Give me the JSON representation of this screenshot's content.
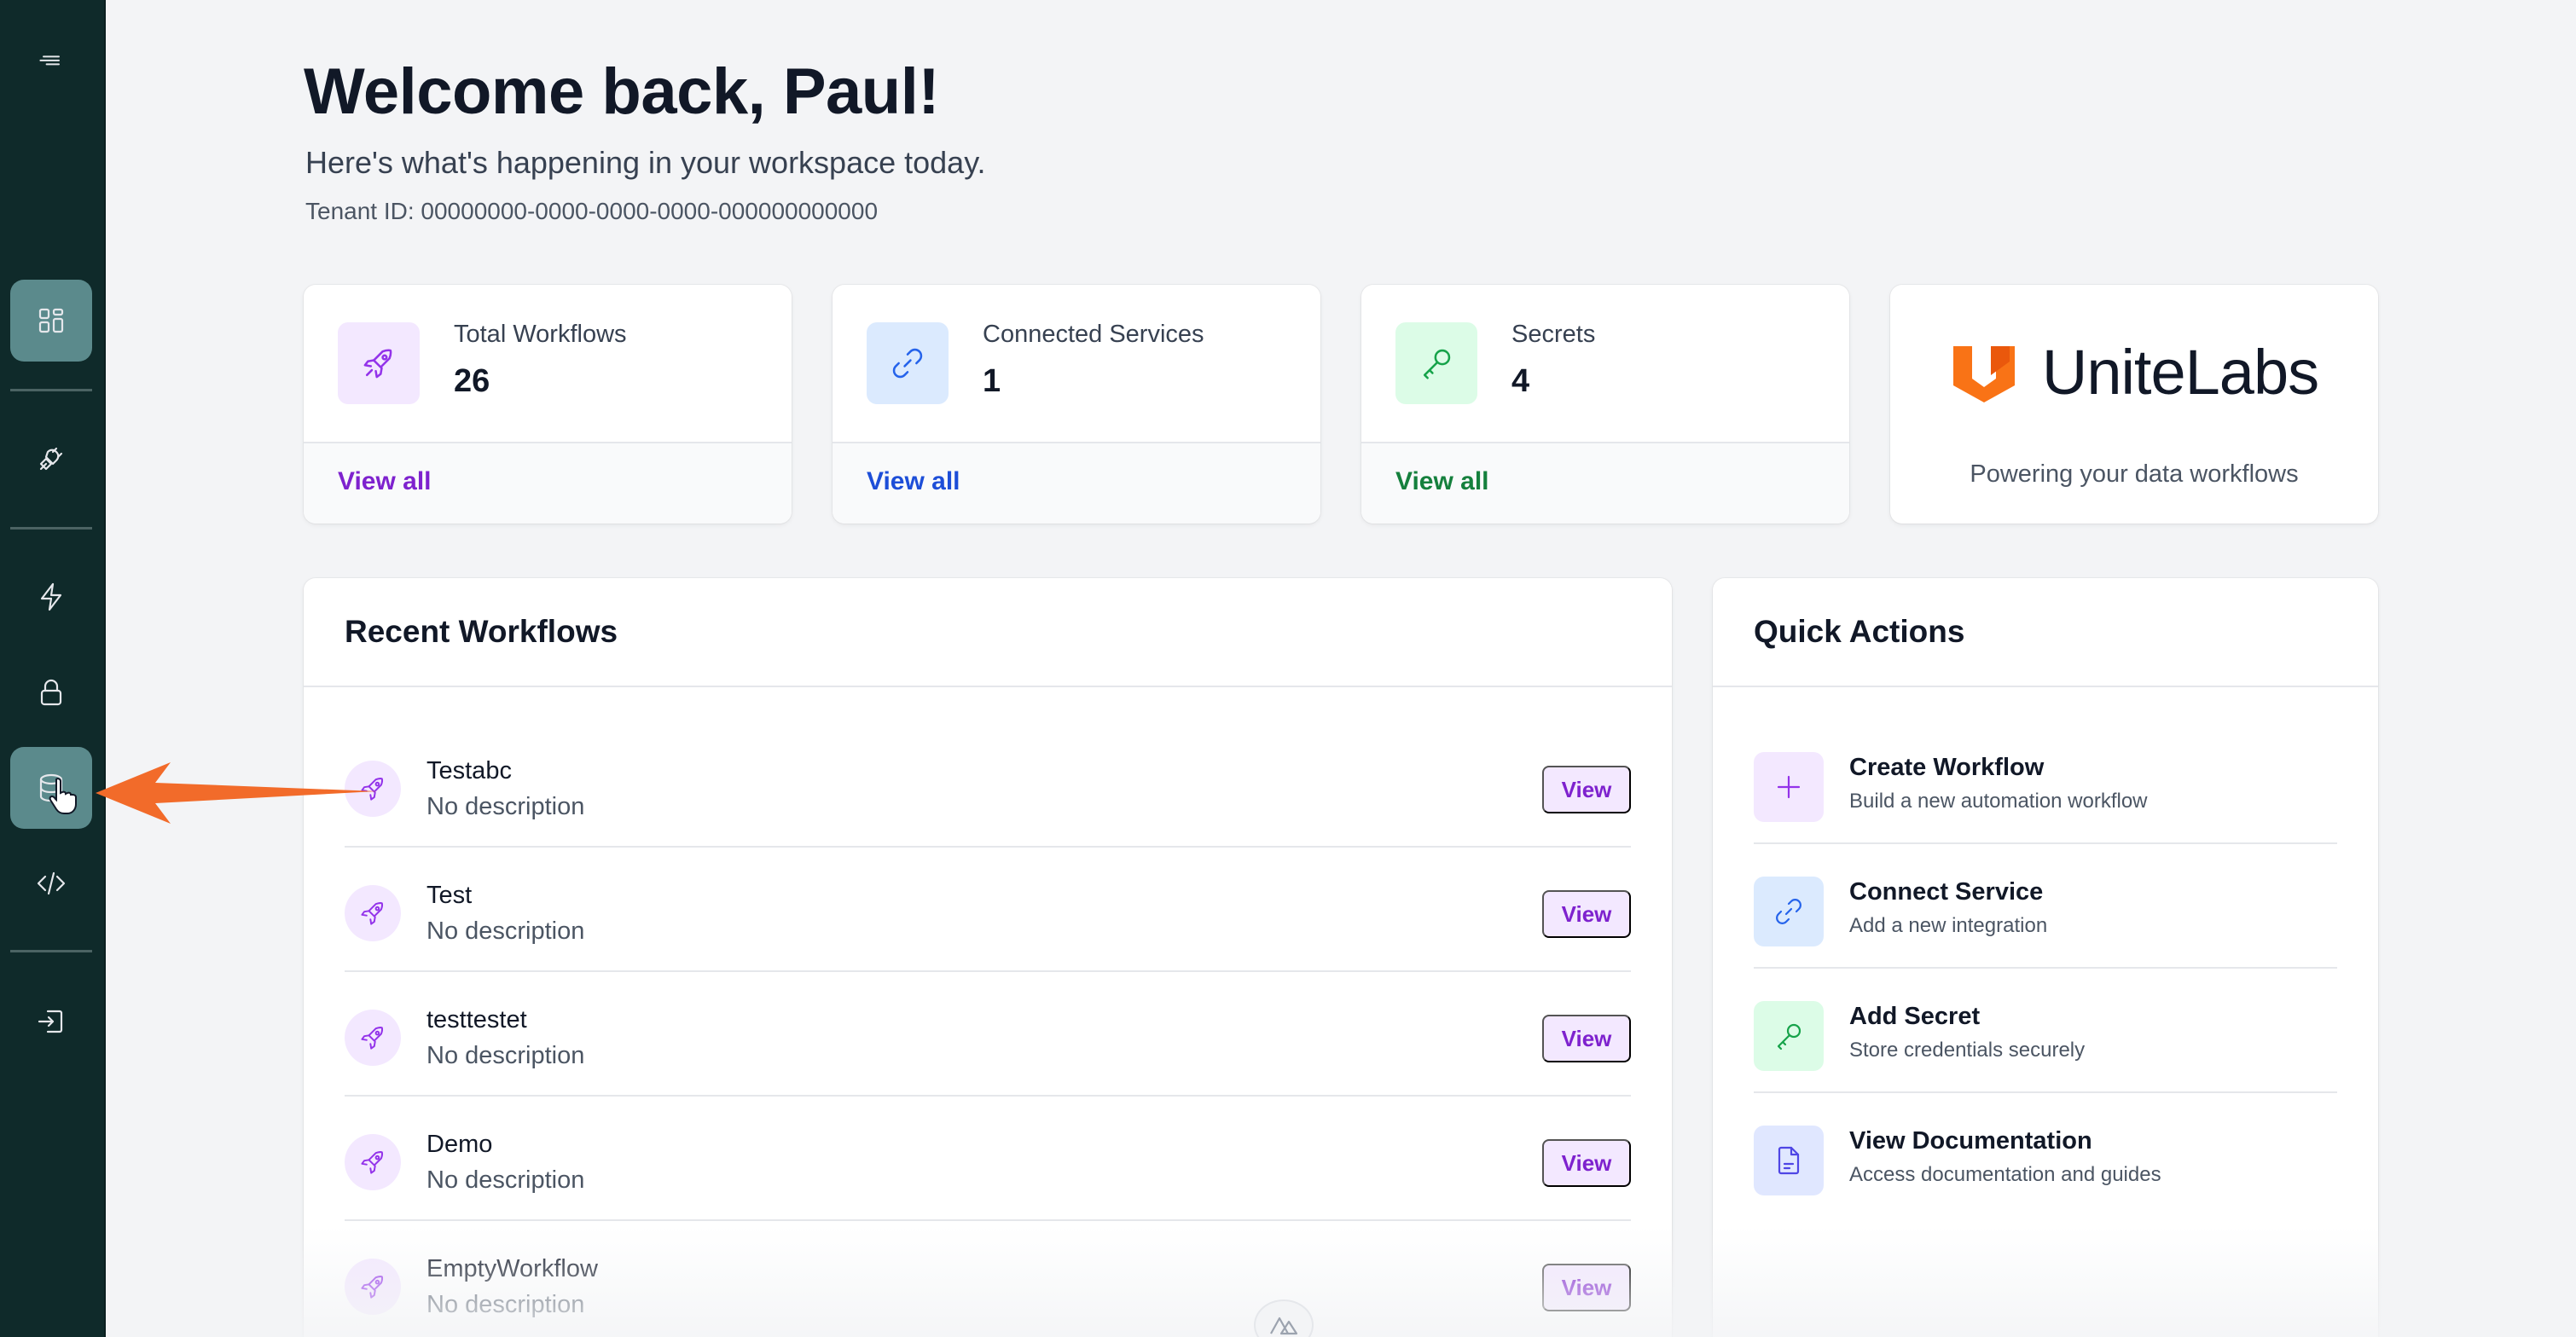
{
  "header": {
    "welcome": "Welcome back, Paul!",
    "subtitle": "Here's what's happening in your workspace today.",
    "tenant": "Tenant ID: 00000000-0000-0000-0000-000000000000"
  },
  "stats": [
    {
      "label": "Total Workflows",
      "value": "26",
      "link": "View all",
      "color": "#7e22ce",
      "icon": "rocket-icon"
    },
    {
      "label": "Connected Services",
      "value": "1",
      "link": "View all",
      "color": "#1d4ed8",
      "icon": "link-icon"
    },
    {
      "label": "Secrets",
      "value": "4",
      "link": "View all",
      "color": "#15803d",
      "icon": "key-icon"
    }
  ],
  "brand": {
    "name": "UniteLabs",
    "tagline": "Powering your data workflows",
    "accent": "#f97316"
  },
  "recent": {
    "title": "Recent Workflows",
    "items": [
      {
        "name": "Testabc",
        "desc": "No description",
        "action": "View"
      },
      {
        "name": "Test",
        "desc": "No description",
        "action": "View"
      },
      {
        "name": "testtestet",
        "desc": "No description",
        "action": "View"
      },
      {
        "name": "Demo",
        "desc": "No description",
        "action": "View"
      },
      {
        "name": "EmptyWorkflow",
        "desc": "No description",
        "action": "View"
      }
    ]
  },
  "quick": {
    "title": "Quick Actions",
    "items": [
      {
        "title": "Create Workflow",
        "desc": "Build a new automation workflow",
        "icon": "plus-icon"
      },
      {
        "title": "Connect Service",
        "desc": "Add a new integration",
        "icon": "link-icon"
      },
      {
        "title": "Add Secret",
        "desc": "Store credentials securely",
        "icon": "key-icon"
      },
      {
        "title": "View Documentation",
        "desc": "Access documentation and guides",
        "icon": "document-icon"
      }
    ]
  },
  "sidebar": {
    "items": [
      "menu-icon",
      "dashboard-icon",
      "plug-icon",
      "lightning-icon",
      "lock-icon",
      "database-icon",
      "code-icon",
      "logout-icon"
    ]
  }
}
